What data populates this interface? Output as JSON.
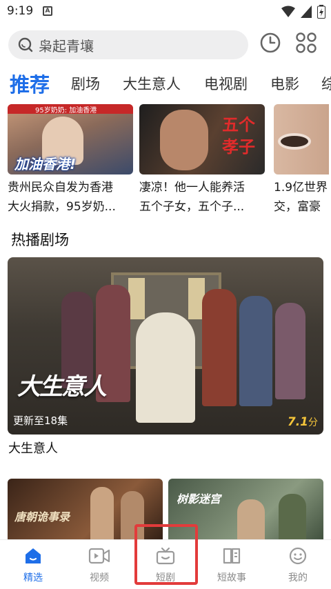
{
  "status_bar": {
    "time": "9:19",
    "notification_glyph": "A"
  },
  "search": {
    "placeholder": "枭起青壤"
  },
  "tabs": [
    {
      "label": "推荐",
      "active": true
    },
    {
      "label": "剧场"
    },
    {
      "label": "大生意人"
    },
    {
      "label": "电视剧"
    },
    {
      "label": "电影"
    },
    {
      "label": "综"
    }
  ],
  "top_items": [
    {
      "overlay": "加油香港!",
      "overlay_top": "95岁奶奶: 加油香港",
      "caption": [
        "贵州民众自发为香港",
        "大火捐款，95岁奶..."
      ]
    },
    {
      "overlay": "五个孝子",
      "caption": [
        "凄凉！他一人能养活",
        "五个子女，五个子..."
      ]
    },
    {
      "caption": [
        "1.9亿世界",
        "交，富豪"
      ]
    }
  ],
  "section": {
    "title": "热播剧场",
    "banner": {
      "title_art": "大生意人",
      "episodes": "更新至18集",
      "rating": "7.1",
      "rating_unit": "分",
      "caption": "大生意人"
    }
  },
  "lower_cards": [
    {
      "overlay": "唐朝诡事录"
    },
    {
      "overlay": "树影迷宫"
    }
  ],
  "bottom_nav": [
    {
      "label": "精选",
      "icon": "home-icon",
      "active": true
    },
    {
      "label": "视频",
      "icon": "video-icon"
    },
    {
      "label": "短剧",
      "icon": "tv-icon"
    },
    {
      "label": "短故事",
      "icon": "book-icon"
    },
    {
      "label": "我的",
      "icon": "smile-icon"
    }
  ],
  "colors": {
    "accent": "#1e6ee8",
    "rating": "#f5c53a",
    "highlight": "#e23b3b"
  }
}
